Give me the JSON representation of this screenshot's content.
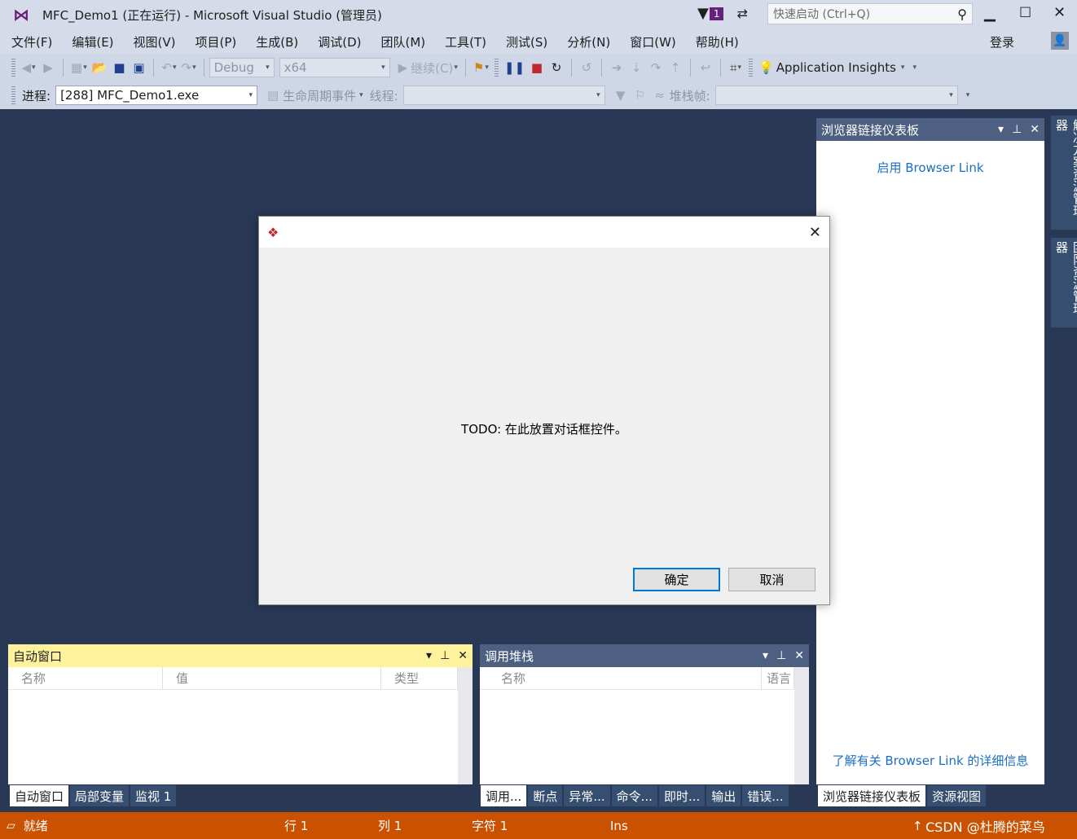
{
  "window": {
    "title": "MFC_Demo1 (正在运行) - Microsoft Visual Studio (管理员)",
    "notification_count": "1"
  },
  "quick_launch": {
    "placeholder": "快速启动 (Ctrl+Q)"
  },
  "account": {
    "sign_in": "登录"
  },
  "menu": [
    "文件(F)",
    "编辑(E)",
    "视图(V)",
    "项目(P)",
    "生成(B)",
    "调试(D)",
    "团队(M)",
    "工具(T)",
    "测试(S)",
    "分析(N)",
    "窗口(W)",
    "帮助(H)"
  ],
  "toolbar": {
    "config": "Debug",
    "platform": "x64",
    "continue_label": "继续(C)",
    "insights": "Application Insights"
  },
  "debug_location": {
    "process_label": "进程:",
    "process_value": "[288] MFC_Demo1.exe",
    "lifecycle_label": "生命周期事件",
    "thread_label": "线程:",
    "stackframe_label": "堆栈帧:"
  },
  "browser_link_panel": {
    "title": "浏览器链接仪表板",
    "enable_link": "启用 Browser Link",
    "learn_more_link": "了解有关 Browser Link 的详细信息",
    "tabs": [
      "浏览器链接仪表板",
      "资源视图"
    ]
  },
  "side_tabs": [
    "解决方案资源管理器",
    "团队资源管理器"
  ],
  "dialog": {
    "message": "TODO: 在此放置对话框控件。",
    "ok": "确定",
    "cancel": "取消"
  },
  "autos_panel": {
    "title": "自动窗口",
    "columns": [
      "名称",
      "值",
      "类型"
    ],
    "tabs": [
      "自动窗口",
      "局部变量",
      "监视 1"
    ]
  },
  "callstack_panel": {
    "title": "调用堆栈",
    "columns": [
      "名称",
      "语言"
    ],
    "tabs": [
      "调用...",
      "断点",
      "异常...",
      "命令...",
      "即时...",
      "输出",
      "错误..."
    ]
  },
  "status": {
    "ready": "就绪",
    "line": "行 1",
    "col": "列 1",
    "char": "字符 1",
    "mode": "Ins",
    "watermark": "CSDN @杜腾的菜鸟"
  },
  "colors": {
    "accent": "#ca5100",
    "panel_header": "#4d6082",
    "active_header": "#fff29d",
    "background": "#293955"
  }
}
